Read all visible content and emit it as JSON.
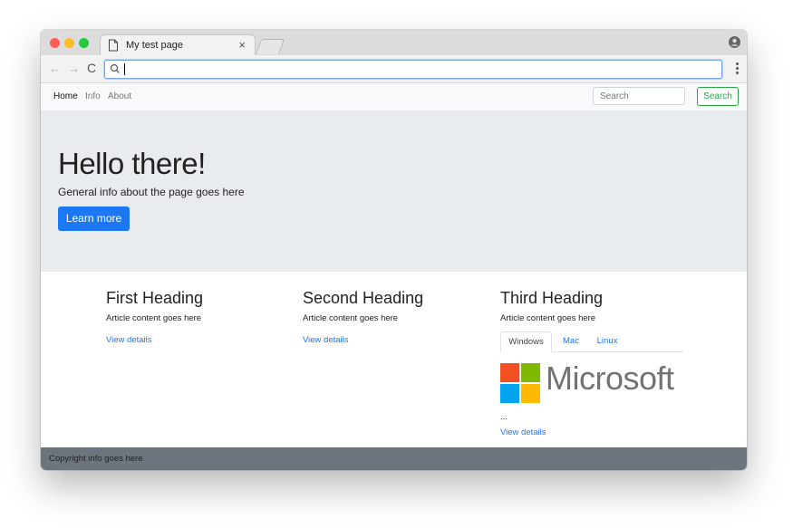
{
  "browser": {
    "tab_title": "My test page",
    "tab_close": "×",
    "nav": {
      "back": "←",
      "forward": "→",
      "reload": "C"
    }
  },
  "navbar": {
    "links": [
      "Home",
      "Info",
      "About"
    ],
    "search_placeholder": "Search",
    "search_button": "Search"
  },
  "jumbotron": {
    "title": "Hello there!",
    "lead": "General info about the page goes here",
    "button": "Learn more"
  },
  "columns": [
    {
      "heading": "First Heading",
      "text": "Article content goes here",
      "link": "View details"
    },
    {
      "heading": "Second Heading",
      "text": "Article content goes here",
      "link": "View details"
    },
    {
      "heading": "Third Heading",
      "text": "Article content goes here",
      "link": "View details",
      "tabs": [
        "Windows",
        "Mac",
        "Linux"
      ],
      "active_tab": "Windows",
      "logo_text": "Microsoft",
      "ellipsis": "..."
    }
  ],
  "footer": {
    "text": "Copyright info goes here"
  },
  "colors": {
    "primary": "#1d78f5",
    "success": "#28a745",
    "jumbotron_bg": "#e9ecef",
    "footer_bg": "#6c757d",
    "ms_red": "#f25022",
    "ms_green": "#7fba00",
    "ms_blue": "#00a4ef",
    "ms_yellow": "#ffb900"
  }
}
